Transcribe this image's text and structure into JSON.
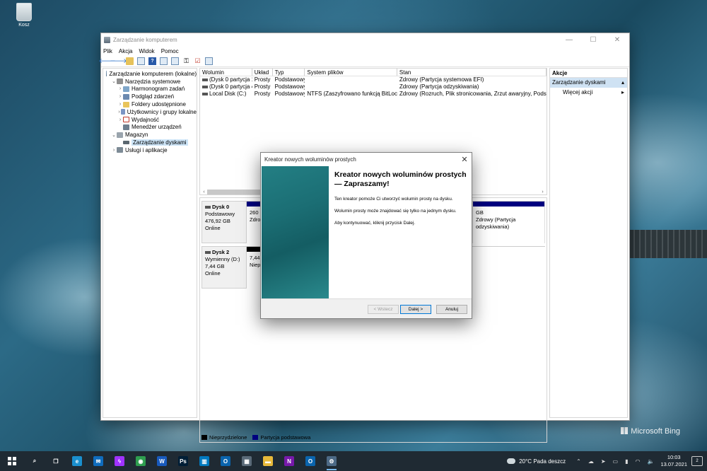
{
  "desktop": {
    "recycle_bin_label": "Kosz",
    "watermark": "Microsoft Bing"
  },
  "window": {
    "title": "Zarządzanie komputerem",
    "menu": [
      "Plik",
      "Akcja",
      "Widok",
      "Pomoc"
    ],
    "tree": [
      {
        "label": "Zarządzanie komputerem (lokalne)",
        "level": 0,
        "expander": "",
        "icon": "computer-icon"
      },
      {
        "label": "Narzędzia systemowe",
        "level": 1,
        "expander": "⌄",
        "icon": "tools-icon"
      },
      {
        "label": "Harmonogram zadań",
        "level": 2,
        "expander": "›",
        "icon": "clock-icon"
      },
      {
        "label": "Podgląd zdarzeń",
        "level": 2,
        "expander": "›",
        "icon": "event-log-icon"
      },
      {
        "label": "Foldery udostępnione",
        "level": 2,
        "expander": "›",
        "icon": "shared-folder-icon"
      },
      {
        "label": "Użytkownicy i grupy lokalne",
        "level": 2,
        "expander": "›",
        "icon": "users-icon"
      },
      {
        "label": "Wydajność",
        "level": 2,
        "expander": "›",
        "icon": "performance-icon"
      },
      {
        "label": "Menedżer urządzeń",
        "level": 2,
        "expander": "",
        "icon": "device-manager-icon"
      },
      {
        "label": "Magazyn",
        "level": 1,
        "expander": "⌄",
        "icon": "storage-icon"
      },
      {
        "label": "Zarządzanie dyskami",
        "level": 2,
        "expander": "",
        "icon": "disk-icon",
        "selected": true
      },
      {
        "label": "Usługi i aplikacje",
        "level": 1,
        "expander": "›",
        "icon": "services-icon"
      }
    ],
    "volumes": {
      "headers": [
        "Wolumin",
        "Układ",
        "Typ",
        "System plików",
        "Stan"
      ],
      "rows": [
        [
          "(Dysk 0 partycja 1)",
          "Prosty",
          "Podstawowy",
          "",
          "Zdrowy (Partycja systemowa EFI)"
        ],
        [
          "(Dysk 0 partycja 4)",
          "Prosty",
          "Podstawowy",
          "",
          "Zdrowy (Partycja odzyskiwania)"
        ],
        [
          "Local Disk (C:)",
          "Prosty",
          "Podstawowy",
          "NTFS (Zaszyfrowano funkcją BitLocker)",
          "Zdrowy (Rozruch, Plik stronicowania, Zrzut awaryjny, Podstawowa"
        ]
      ]
    },
    "disks": [
      {
        "name": "Dysk 0",
        "type": "Podstawowy",
        "size": "476,92 GB",
        "status": "Online",
        "partitions": [
          {
            "line1": "260 M",
            "line2": "Zdrow"
          },
          {
            "line1": "GB",
            "line2": "Zdrowy (Partycja odzyskiwania)"
          }
        ]
      },
      {
        "name": "Dysk 2",
        "type": "Wymienny (D:)",
        "size": "7,44 GB",
        "status": "Online",
        "partitions": [
          {
            "line1": "7,44 G",
            "line2": "Niep"
          }
        ]
      }
    ],
    "legend": [
      {
        "label": "Nieprzydzielone",
        "color": "#000000"
      },
      {
        "label": "Partycja podstawowa",
        "color": "#00007f"
      }
    ],
    "actions": {
      "header": "Akcje",
      "section": "Zarządzanie dyskami",
      "more": "Więcej akcji"
    }
  },
  "wizard": {
    "title": "Kreator nowych woluminów prostych",
    "heading": "Kreator nowych woluminów prostych — Zapraszamy!",
    "paragraphs": [
      "Ten kreator pomoże Ci utworzyć wolumin prosty na dysku.",
      "Wolumin prosty może znajdować się tylko na jednym dysku.",
      "Aby kontynuować, kliknij przycisk Dalej."
    ],
    "back_label": "< Wstecz",
    "next_label": "Dalej >",
    "cancel_label": "Anuluj"
  },
  "taskbar": {
    "weather_temp": "20°C",
    "weather_text": "Pada deszcz",
    "time": "10:03",
    "date": "13.07.2021",
    "notifications": "2",
    "apps": [
      {
        "name": "search-icon",
        "glyph": "⌕",
        "color": "transparent"
      },
      {
        "name": "task-view-icon",
        "glyph": "❐",
        "color": "transparent"
      },
      {
        "name": "edge-icon",
        "glyph": "e",
        "color": "#1a8fce"
      },
      {
        "name": "mail-icon",
        "glyph": "✉",
        "color": "#0f6cbd"
      },
      {
        "name": "messenger-icon",
        "glyph": "ϟ",
        "color": "#a033ff"
      },
      {
        "name": "chrome-icon",
        "glyph": "◉",
        "color": "#2e9e4f"
      },
      {
        "name": "word-icon",
        "glyph": "W",
        "color": "#185abd"
      },
      {
        "name": "photoshop-icon",
        "glyph": "Ps",
        "color": "#001e36"
      },
      {
        "name": "trello-icon",
        "glyph": "▥",
        "color": "#0079bf"
      },
      {
        "name": "outlook-icon",
        "glyph": "O",
        "color": "#0a64ad"
      },
      {
        "name": "calculator-icon",
        "glyph": "▦",
        "color": "#5a6a78"
      },
      {
        "name": "explorer-icon",
        "glyph": "▬",
        "color": "#e8b93a"
      },
      {
        "name": "onenote-icon",
        "glyph": "N",
        "color": "#7719aa"
      },
      {
        "name": "outlook2-icon",
        "glyph": "O",
        "color": "#0a64ad"
      },
      {
        "name": "computer-management-icon",
        "glyph": "⚙",
        "color": "#4d6a86"
      }
    ]
  }
}
